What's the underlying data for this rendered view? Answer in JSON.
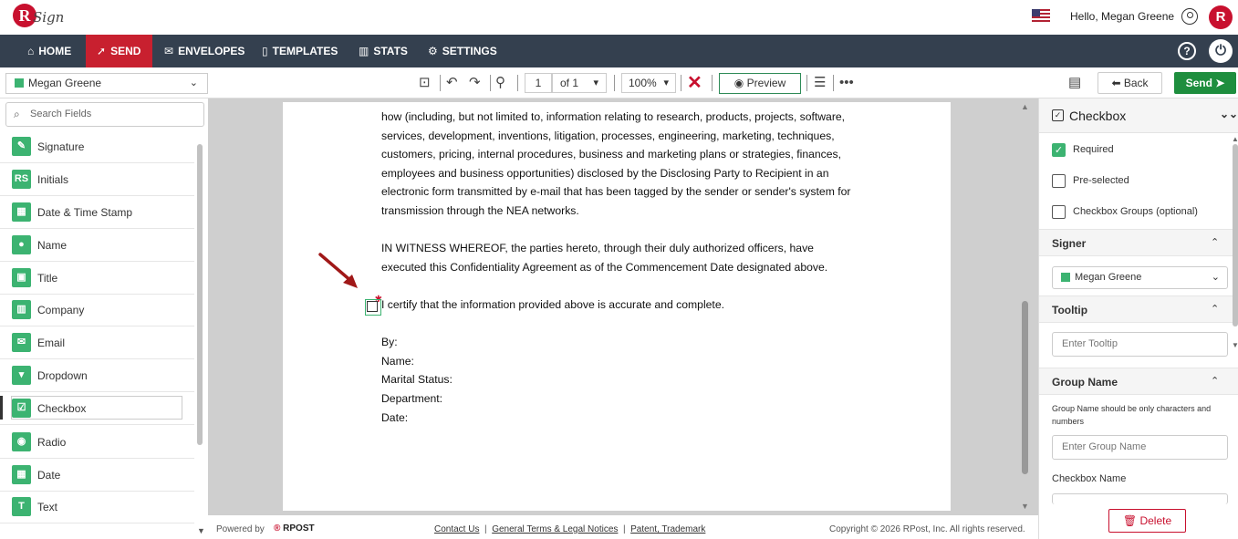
{
  "app": {
    "logo_letter": "R",
    "logo_text": "Sign"
  },
  "header": {
    "greeting": "Hello, Megan Greene",
    "avatar_letter": "R"
  },
  "nav": {
    "items": [
      {
        "label": "HOME",
        "icon": "home-icon"
      },
      {
        "label": "SEND",
        "icon": "send-icon"
      },
      {
        "label": "ENVELOPES",
        "icon": "envelope-icon"
      },
      {
        "label": "TEMPLATES",
        "icon": "template-icon"
      },
      {
        "label": "STATS",
        "icon": "stats-icon"
      },
      {
        "label": "SETTINGS",
        "icon": "gear-icon"
      }
    ],
    "active": "SEND",
    "help": "?",
    "power": "⏻"
  },
  "toolbar": {
    "signer": "Megan Greene",
    "page": "1",
    "page_of": "of  1",
    "zoom": "100%",
    "preview_label": "Preview",
    "back_label": "Back",
    "send_label": "Send",
    "signer_color": "#3cb371"
  },
  "left_panel": {
    "search_placeholder": "Search Fields",
    "fields": [
      {
        "label": "Signature",
        "icon": "signature-icon"
      },
      {
        "label": "Initials",
        "icon": "initials-icon"
      },
      {
        "label": "Date & Time Stamp",
        "icon": "calendar-clock-icon"
      },
      {
        "label": "Name",
        "icon": "person-icon"
      },
      {
        "label": "Title",
        "icon": "briefcase-icon"
      },
      {
        "label": "Company",
        "icon": "building-icon"
      },
      {
        "label": "Email",
        "icon": "mail-icon"
      },
      {
        "label": "Dropdown",
        "icon": "dropdown-icon"
      },
      {
        "label": "Checkbox",
        "icon": "checkbox-icon"
      },
      {
        "label": "Radio",
        "icon": "radio-icon"
      },
      {
        "label": "Date",
        "icon": "calendar-icon"
      },
      {
        "label": "Text",
        "icon": "text-icon"
      }
    ],
    "active_field": "Checkbox"
  },
  "document": {
    "lines": [
      "how (including, but not limited to, information relating to research, products, projects, software,",
      "services, development, inventions, litigation, processes, engineering, marketing, techniques,",
      "customers, pricing, internal procedures, business and marketing plans or strategies, finances,",
      "employees and business opportunities) disclosed by the Disclosing Party to Recipient in an",
      "electronic form transmitted by e-mail that has been tagged by the sender or sender's system for",
      "transmission through the NEA networks.",
      "IN WITNESS WHEREOF, the parties hereto, through their duly authorized officers, have",
      "executed this Confidentiality Agreement as of the Commencement Date designated above.",
      "I certify that the information provided above is accurate and complete.",
      "By:",
      "Name:",
      "Marital Status:",
      "Department:",
      "Date:"
    ]
  },
  "footer": {
    "powered_by": "Powered by",
    "brand": "RPOST",
    "contact": "Contact Us",
    "terms": "General Terms & Legal Notices",
    "patent": "Patent, Trademark",
    "copyright": "Copyright © 2026 RPost, Inc. All rights reserved."
  },
  "right_panel": {
    "title": "Checkbox",
    "options": {
      "required": "Required",
      "preselected": "Pre-selected",
      "groups": "Checkbox Groups (optional)"
    },
    "required_checked": true,
    "preselected_checked": false,
    "groups_checked": false,
    "signer_section": "Signer",
    "signer_value": "Megan Greene",
    "tooltip_section": "Tooltip",
    "tooltip_placeholder": "Enter Tooltip",
    "group_section": "Group Name",
    "group_hint": "Group Name should be only characters and numbers",
    "group_placeholder": "Enter Group Name",
    "checkbox_name_label": "Checkbox Name",
    "delete_label": "Delete"
  }
}
